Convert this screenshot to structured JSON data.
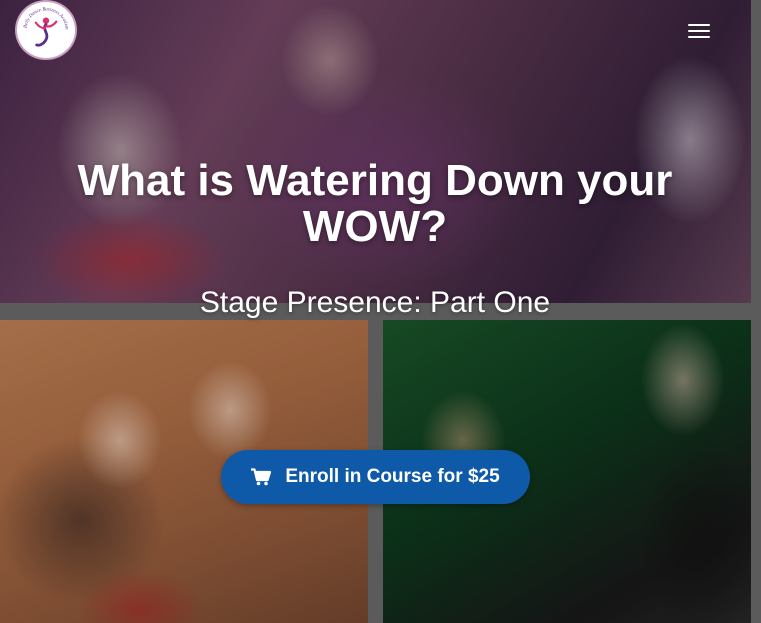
{
  "logo": {
    "alt": "Belly Dance Business Academy",
    "ring_text": "Belly Dance Business Academy"
  },
  "nav": {
    "menu_icon": "hamburger-menu-icon"
  },
  "hero": {
    "title": "What is Watering Down your WOW?",
    "subtitle": "Stage Presence: Part One"
  },
  "cta": {
    "icon": "shopping-cart-icon",
    "label": "Enroll in Course for $25",
    "color": "#0e5aa9"
  }
}
